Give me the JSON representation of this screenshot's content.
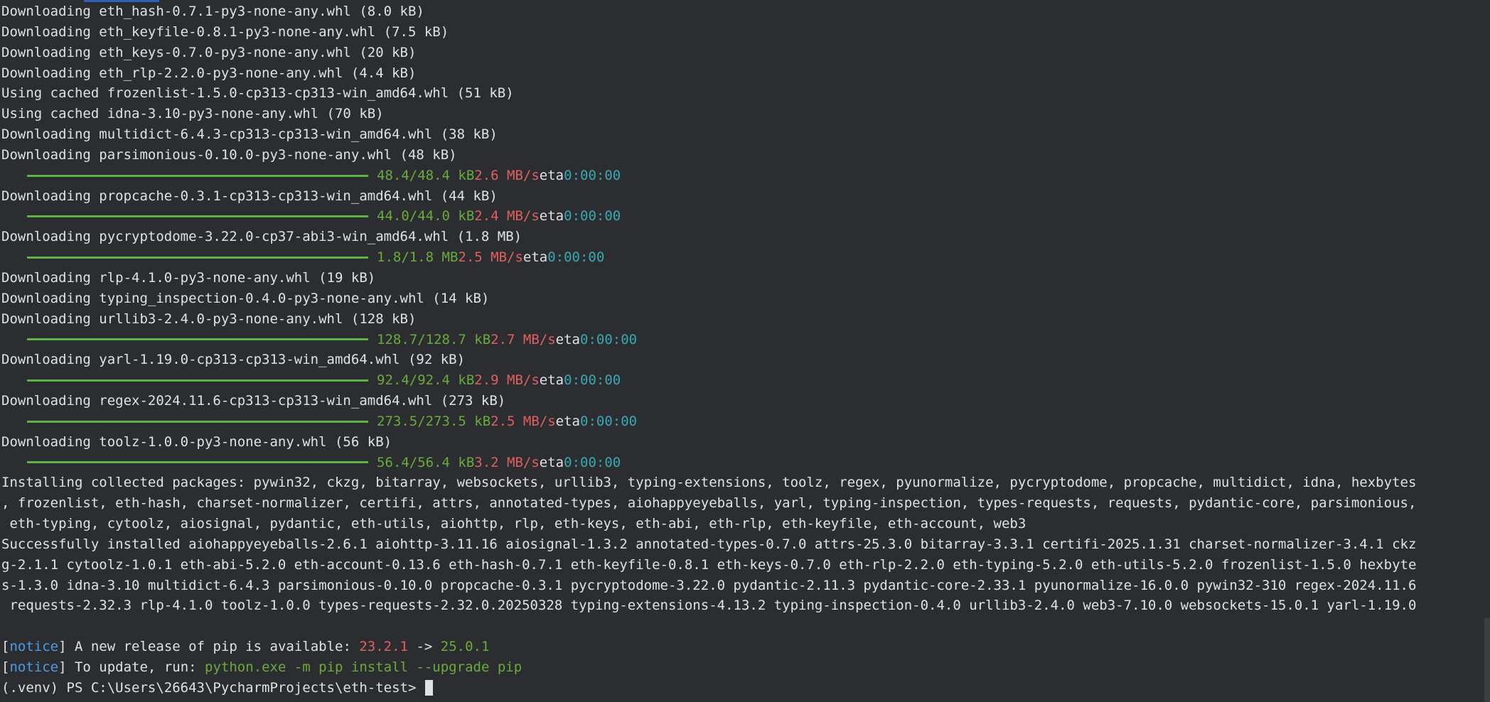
{
  "download_lines": [
    "Downloading eth_hash-0.7.1-py3-none-any.whl (8.0 kB)",
    "Downloading eth_keyfile-0.8.1-py3-none-any.whl (7.5 kB)",
    "Downloading eth_keys-0.7.0-py3-none-any.whl (20 kB)",
    "Downloading eth_rlp-2.2.0-py3-none-any.whl (4.4 kB)",
    "Using cached frozenlist-1.5.0-cp313-cp313-win_amd64.whl (51 kB)",
    "Using cached idna-3.10-py3-none-any.whl (70 kB)",
    "Downloading multidict-6.4.3-cp313-cp313-win_amd64.whl (38 kB)",
    "Downloading parsimonious-0.10.0-py3-none-any.whl (48 kB)"
  ],
  "progress": [
    {
      "size": "48.4/48.4 kB",
      "speed": "2.6 MB/s",
      "eta_label": "eta",
      "eta": "0:00:00",
      "fraction": 1.0
    },
    {
      "size": "44.0/44.0 kB",
      "speed": "2.4 MB/s",
      "eta_label": "eta",
      "eta": "0:00:00",
      "fraction": 1.0
    },
    {
      "size": "1.8/1.8 MB",
      "speed": "2.5 MB/s",
      "eta_label": "eta",
      "eta": "0:00:00",
      "fraction": 1.0
    },
    {
      "size": "128.7/128.7 kB",
      "speed": "2.7 MB/s",
      "eta_label": "eta",
      "eta": "0:00:00",
      "fraction": 1.0
    },
    {
      "size": "92.4/92.4 kB",
      "speed": "2.9 MB/s",
      "eta_label": "eta",
      "eta": "0:00:00",
      "fraction": 1.0
    },
    {
      "size": "273.5/273.5 kB",
      "speed": "2.5 MB/s",
      "eta_label": "eta",
      "eta": "0:00:00",
      "fraction": 1.0
    },
    {
      "size": "56.4/56.4 kB",
      "speed": "3.2 MB/s",
      "eta_label": "eta",
      "eta": "0:00:00",
      "fraction": 1.0
    }
  ],
  "downloads_after": [
    "Downloading propcache-0.3.1-cp313-cp313-win_amd64.whl (44 kB)",
    "Downloading pycryptodome-3.22.0-cp37-abi3-win_amd64.whl (1.8 MB)",
    "Downloading rlp-4.1.0-py3-none-any.whl (19 kB)",
    "Downloading typing_inspection-0.4.0-py3-none-any.whl (14 kB)",
    "Downloading urllib3-2.4.0-py3-none-any.whl (128 kB)",
    "Downloading yarl-1.19.0-cp313-cp313-win_amd64.whl (92 kB)",
    "Downloading regex-2024.11.6-cp313-cp313-win_amd64.whl (273 kB)",
    "Downloading toolz-1.0.0-py3-none-any.whl (56 kB)"
  ],
  "installing_lines": [
    "Installing collected packages: pywin32, ckzg, bitarray, websockets, urllib3, typing-extensions, toolz, regex, pyunormalize, pycryptodome, propcache, multidict, idna, hexbytes",
    ", frozenlist, eth-hash, charset-normalizer, certifi, attrs, annotated-types, aiohappyeyeballs, yarl, typing-inspection, types-requests, requests, pydantic-core, parsimonious,",
    " eth-typing, cytoolz, aiosignal, pydantic, eth-utils, aiohttp, rlp, eth-keys, eth-abi, eth-rlp, eth-keyfile, eth-account, web3"
  ],
  "success_lines": [
    "Successfully installed aiohappyeyeballs-2.6.1 aiohttp-3.11.16 aiosignal-1.3.2 annotated-types-0.7.0 attrs-25.3.0 bitarray-3.3.1 certifi-2025.1.31 charset-normalizer-3.4.1 ckz",
    "g-2.1.1 cytoolz-1.0.1 eth-abi-5.2.0 eth-account-0.13.6 eth-hash-0.7.1 eth-keyfile-0.8.1 eth-keys-0.7.0 eth-rlp-2.2.0 eth-typing-5.2.0 eth-utils-5.2.0 frozenlist-1.5.0 hexbyte",
    "s-1.3.0 idna-3.10 multidict-6.4.3 parsimonious-0.10.0 propcache-0.3.1 pycryptodome-3.22.0 pydantic-2.11.3 pydantic-core-2.33.1 pyunormalize-16.0.0 pywin32-310 regex-2024.11.6",
    " requests-2.32.3 rlp-4.1.0 toolz-1.0.0 types-requests-2.32.0.20250328 typing-extensions-4.13.2 typing-inspection-0.4.0 urllib3-2.4.0 web3-7.10.0 websockets-15.0.1 yarl-1.19.0"
  ],
  "notice1": {
    "open": "[",
    "tag": "notice",
    "close": "]",
    "text": " A new release of pip is available: ",
    "old_version": "23.2.1",
    "arrow": " -> ",
    "new_version": "25.0.1"
  },
  "notice2": {
    "open": "[",
    "tag": "notice",
    "close": "]",
    "text": " To update, run: ",
    "command": "python.exe -m pip install --upgrade pip"
  },
  "prompt": "(.venv) PS C:\\Users\\26643\\PycharmProjects\\eth-test> ",
  "colors": {
    "background": "#2b2d30",
    "text": "#dfe1e5",
    "progress_bar": "#5fb244",
    "size_text": "#6aab3c",
    "speed_text": "#e06060",
    "eta_text": "#37a8b4",
    "notice_tag": "#4a9ee8"
  }
}
